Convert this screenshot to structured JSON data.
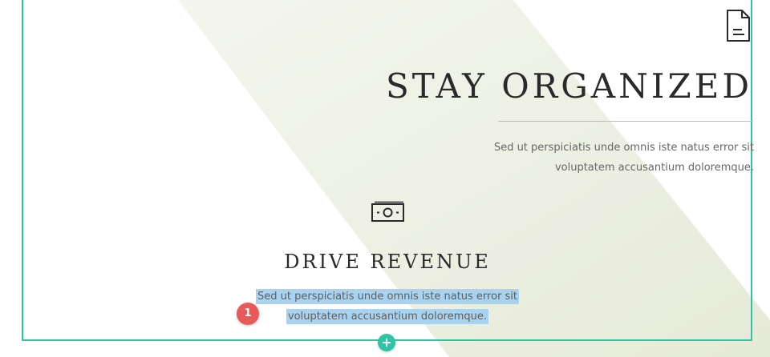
{
  "colors": {
    "frame_accent": "#2ec4a6",
    "band": "#eef1e4",
    "heading_text": "#2a2a2a",
    "body_text": "#666666",
    "selection_highlight": "#a9d2ef",
    "badge": "#e85a5a"
  },
  "feature_right": {
    "icon": "document-icon",
    "heading": "STAY ORGANIZED",
    "body_line_1": "Sed ut perspiciatis unde omnis iste natus error sit",
    "body_line_2": "voluptatem accusantium doloremque."
  },
  "feature_center": {
    "icon": "money-icon",
    "heading": "DRIVE REVENUE",
    "body_line_1": "Sed ut perspiciatis unde omnis iste natus error sit",
    "body_line_2": "voluptatem accusantium doloremque."
  },
  "annotation": {
    "badge_number": "1"
  },
  "controls": {
    "add_section_symbol": "+"
  }
}
